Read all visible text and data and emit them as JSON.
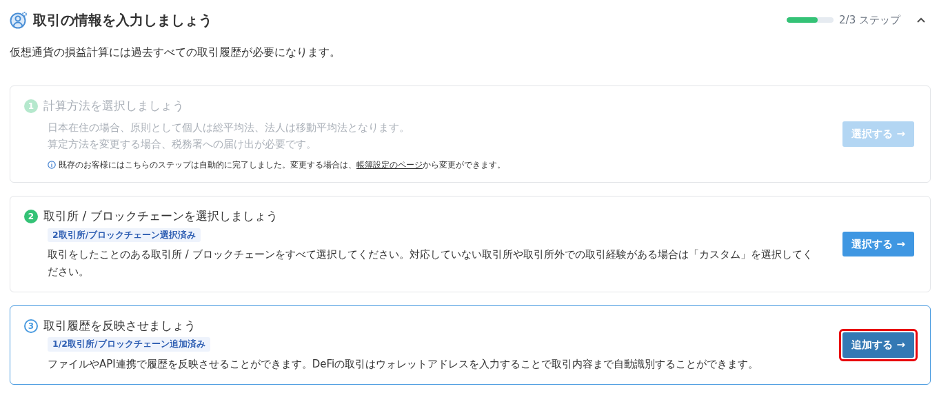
{
  "header": {
    "title": "取引の情報を入力しましょう",
    "progress": {
      "level": 0.667,
      "reading": "2/3 ステップ"
    },
    "expanded": true
  },
  "subtitle": "仮想通貨の損益計算には過去すべての取引履歴が必要になります。",
  "steps": [
    {
      "number": "1",
      "kind": "done",
      "title": "計算方法を選択しましょう",
      "description": [
        "日本在住の場合、原則として個人は総平均法、法人は移動平均法となります。",
        "算定方法を変更する場合、税務署への届け出が必要です。"
      ],
      "note": {
        "before": "既存のお客様にはこちらのステップは自動的に完了しました。変更する場合は、",
        "link": "帳簿設定のページ",
        "after": "から変更ができます。"
      },
      "button": {
        "label": "選択する →",
        "disabled": true,
        "highlighted": false
      }
    },
    {
      "number": "2",
      "kind": "complete",
      "title": "取引所 / ブロックチェーンを選択しましょう",
      "badge": "2取引所/ブロックチェーン選択済み",
      "description": [
        "取引をしたことのある取引所 / ブロックチェーンをすべて選択してください。対応していない取引所や取引所外での取引経験がある場合は「カスタム」を選択してください。"
      ],
      "button": {
        "label": "選択する →",
        "disabled": false,
        "highlighted": false
      }
    },
    {
      "number": "3",
      "kind": "active",
      "title": "取引履歴を反映させましょう",
      "badge": "1/2取引所/ブロックチェーン追加済み",
      "description": [
        "ファイルやAPI連携で履歴を反映させることができます。DeFiの取引はウォレットアドレスを入力することで取引内容まで自動識別することができます。"
      ],
      "button": {
        "label": "追加する →",
        "disabled": false,
        "highlighted": true
      }
    }
  ]
}
